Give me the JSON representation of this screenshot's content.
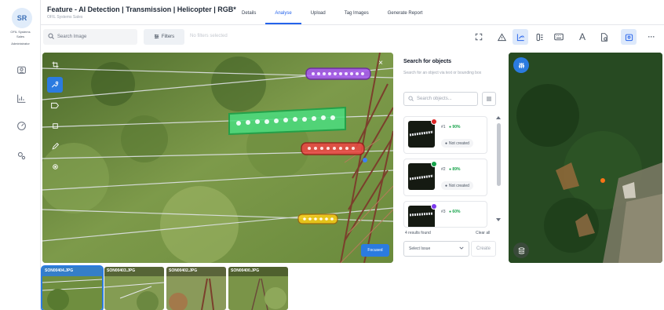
{
  "user": {
    "initials": "SR",
    "org_line1": "OFIL Systems",
    "org_line2": "Sales",
    "role": "Administrator"
  },
  "rail": {
    "icons": [
      "user-pin-icon",
      "chart-icon",
      "gauge-icon",
      "settings-icon"
    ]
  },
  "header": {
    "title": "Feature - AI Detection | Transmission | Helicopter | RGB*",
    "subtitle": "OFIL Systems Sales",
    "tabs": [
      {
        "label": "Details",
        "active": false
      },
      {
        "label": "Analyse",
        "active": true
      },
      {
        "label": "Upload",
        "active": false
      },
      {
        "label": "Tag Images",
        "active": false
      },
      {
        "label": "Generate Report",
        "active": false
      }
    ]
  },
  "toolbar": {
    "search_placeholder": "Search Image",
    "filters_label": "Filters",
    "no_filters": "No filters selected",
    "tools": [
      "expand-icon",
      "warning-icon",
      "annotate-icon",
      "layers-icon",
      "keyboard-icon",
      "text-icon",
      "document-icon",
      "map-pin-icon",
      "more-icon"
    ],
    "text_tool_glyph": "A",
    "more_glyph": "···"
  },
  "viewer": {
    "focused_label": "Focused",
    "close_glyph": "×",
    "left_tools": [
      "crop-icon",
      "detect-icon",
      "label-icon",
      "box-icon",
      "pen-icon",
      "point-icon"
    ]
  },
  "object_panel": {
    "title": "Search for objects",
    "description": "Search for an object via text or bounding box",
    "search_placeholder": "Search objects...",
    "items": [
      {
        "number": "#1",
        "confidence": "90%",
        "status": "Not created",
        "dot_color": "#dc2626"
      },
      {
        "number": "#2",
        "confidence": "89%",
        "status": "Not created",
        "dot_color": "#16a34a"
      },
      {
        "number": "#3",
        "confidence": "60%",
        "status": "Not created",
        "dot_color": "#7c3aed"
      }
    ],
    "results_found": "4 results found",
    "clear_all": "Clear all",
    "select_issue": "Select Issue",
    "create": "Create"
  },
  "filmstrip": [
    {
      "name": "SON00404.JPG",
      "active": true
    },
    {
      "name": "SON00403.JPG",
      "active": false
    },
    {
      "name": "SON00402.JPG",
      "active": false
    },
    {
      "name": "SON00400.JPG",
      "active": false
    }
  ],
  "colors": {
    "accent": "#2563eb",
    "box_purple": "#8b2fd6",
    "box_green": "#22c55e",
    "box_red": "#dc2626",
    "box_yellow": "#eab308"
  }
}
